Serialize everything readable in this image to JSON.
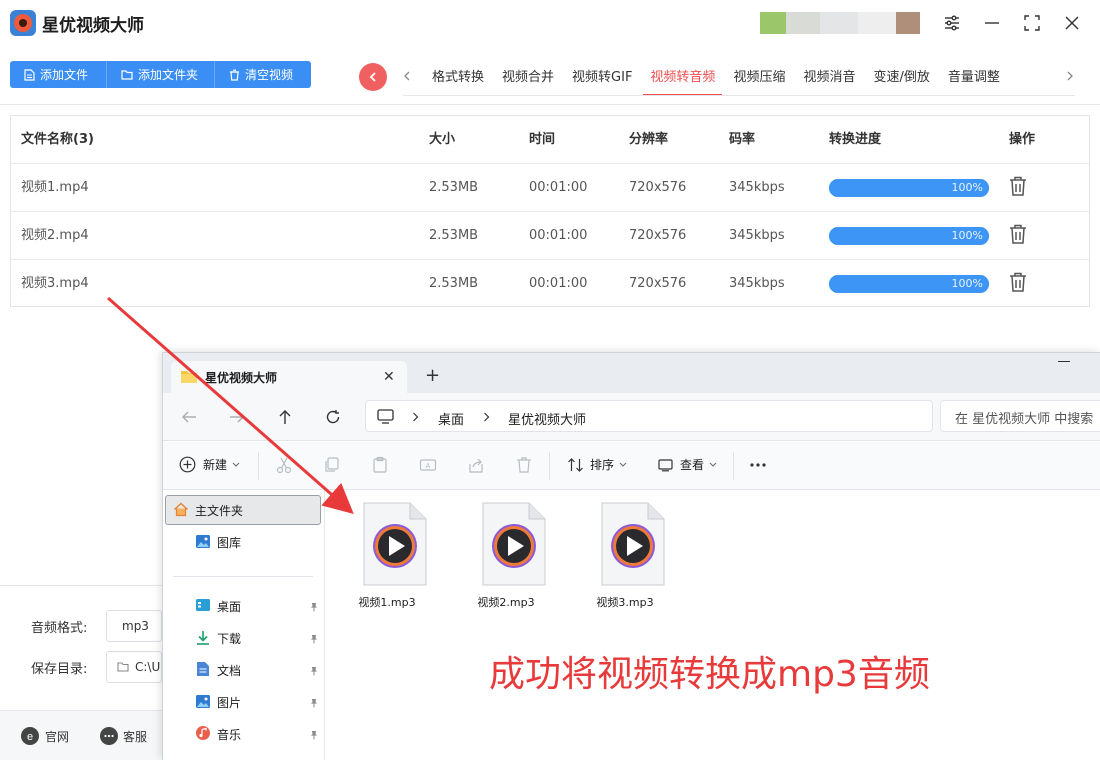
{
  "app": {
    "title": "星优视频大师"
  },
  "toolbar": {
    "add_file": "添加文件",
    "add_folder": "添加文件夹",
    "clear": "清空视频"
  },
  "tabs": [
    {
      "label": "格式转换",
      "active": false
    },
    {
      "label": "视频合并",
      "active": false
    },
    {
      "label": "视频转GIF",
      "active": false
    },
    {
      "label": "视频转音频",
      "active": true
    },
    {
      "label": "视频压缩",
      "active": false
    },
    {
      "label": "视频消音",
      "active": false
    },
    {
      "label": "变速/倒放",
      "active": false
    },
    {
      "label": "音量调整",
      "active": false
    }
  ],
  "table": {
    "headers": {
      "name": "文件名称(3)",
      "size": "大小",
      "time": "时间",
      "resolution": "分辨率",
      "bitrate": "码率",
      "progress": "转换进度",
      "action": "操作"
    },
    "rows": [
      {
        "name": "视频1.mp4",
        "size": "2.53MB",
        "time": "00:01:00",
        "resolution": "720x576",
        "bitrate": "345kbps",
        "progress_label": "100%",
        "progress": 1.0
      },
      {
        "name": "视频2.mp4",
        "size": "2.53MB",
        "time": "00:01:00",
        "resolution": "720x576",
        "bitrate": "345kbps",
        "progress_label": "100%",
        "progress": 1.0
      },
      {
        "name": "视频3.mp4",
        "size": "2.53MB",
        "time": "00:01:00",
        "resolution": "720x576",
        "bitrate": "345kbps",
        "progress_label": "100%",
        "progress": 1.0
      }
    ]
  },
  "settings": {
    "format_label": "音频格式:",
    "format_value": "mp3",
    "savedir_label": "保存目录:",
    "savedir_value": "C:\\U"
  },
  "footer": {
    "website": "官网",
    "support": "客服"
  },
  "explorer": {
    "tab_title": "星优视频大师",
    "breadcrumb": [
      "桌面",
      "星优视频大师"
    ],
    "search_placeholder": "在 星优视频大师 中搜索",
    "commands": {
      "new": "新建",
      "sort": "排序",
      "view": "查看"
    },
    "nav": {
      "home": "主文件夹",
      "gallery": "图库",
      "desktop": "桌面",
      "downloads": "下载",
      "documents": "文档",
      "pictures": "图片",
      "music": "音乐"
    },
    "files": [
      {
        "name": "视频1.mp3"
      },
      {
        "name": "视频2.mp3"
      },
      {
        "name": "视频3.mp3"
      }
    ]
  },
  "annotation": "成功将视频转换成mp3音频",
  "colors": {
    "primary": "#3b8ff4",
    "active_tab": "#ee4e4e",
    "progress": "#3d96f5",
    "annotation": "#e83a3a"
  }
}
